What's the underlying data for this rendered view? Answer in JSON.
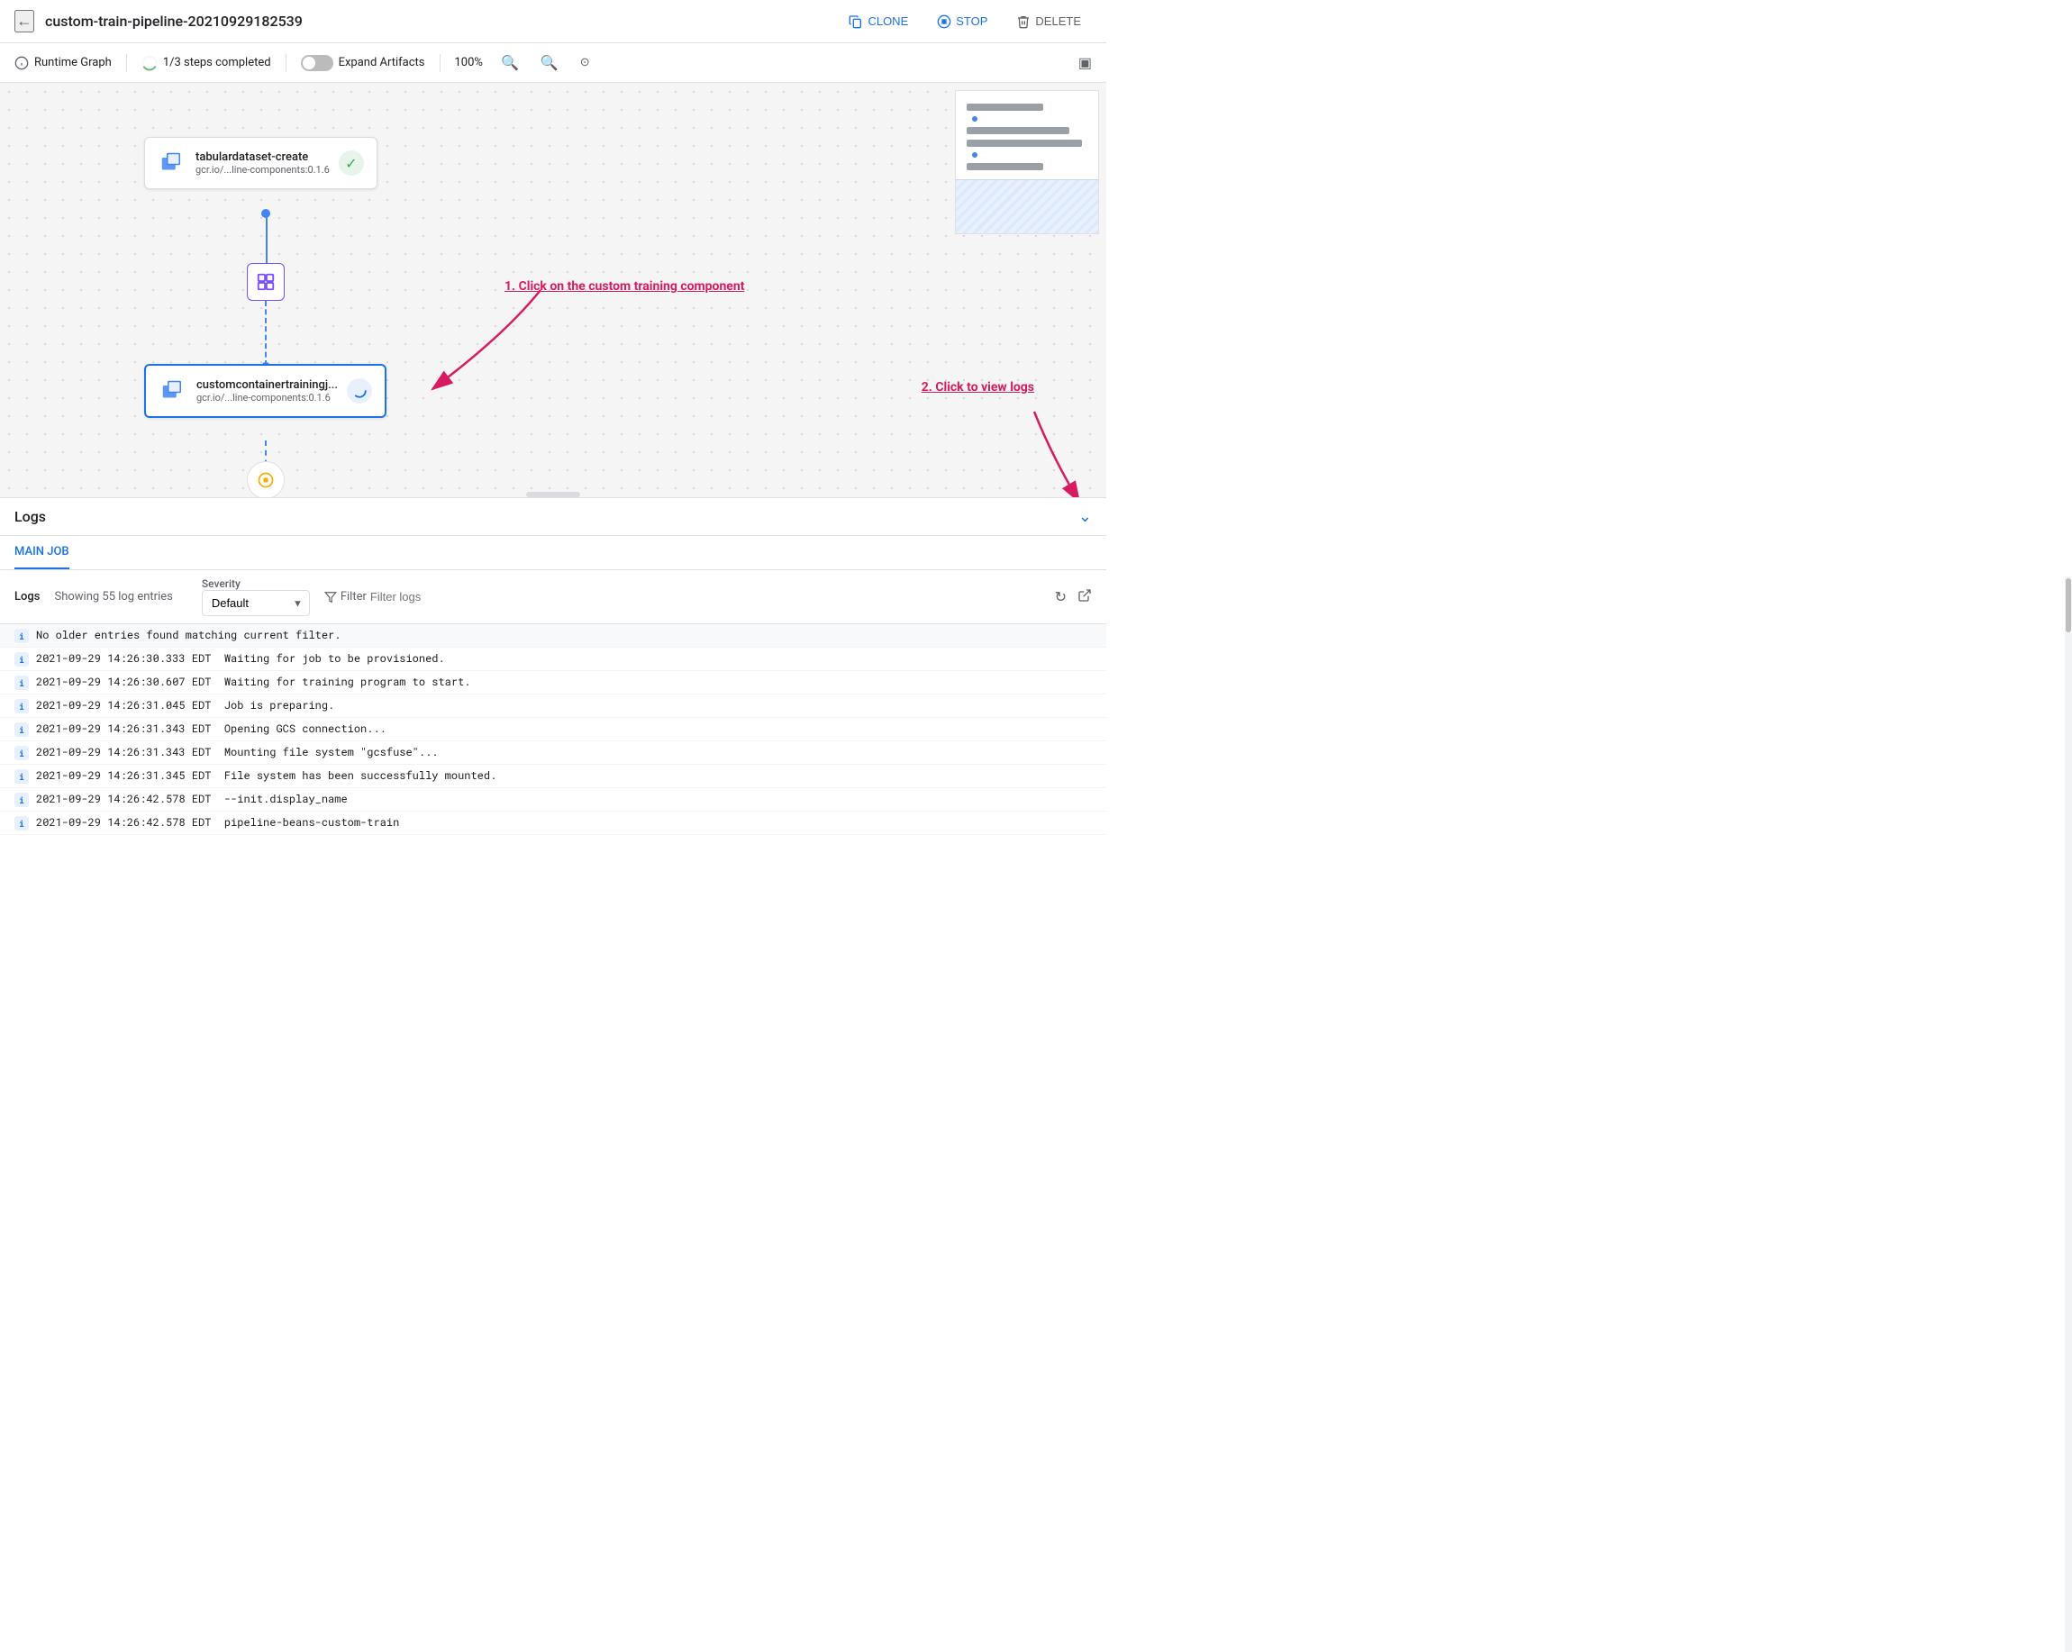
{
  "header": {
    "back_label": "←",
    "title": "custom-train-pipeline-20210929182539",
    "clone_label": "CLONE",
    "stop_label": "STOP",
    "delete_label": "DELETE"
  },
  "toolbar": {
    "runtime_graph_label": "Runtime Graph",
    "steps_completed_label": "1/3 steps completed",
    "expand_artifacts_label": "Expand Artifacts",
    "zoom_level": "100%"
  },
  "pipeline": {
    "node1": {
      "name": "tabulardataset-create",
      "sub": "gcr.io/...line-components:0.1.6",
      "status": "success"
    },
    "node2": {
      "name": "customcontainertrainingj...",
      "sub": "gcr.io/...line-components:0.1.6",
      "status": "running"
    }
  },
  "annotations": {
    "step1": "1. Click on the custom training component",
    "step2": "2. Click to view logs"
  },
  "logs": {
    "title": "Logs",
    "tab_main": "MAIN JOB",
    "label": "Logs",
    "count": "Showing 55 log entries",
    "severity_label": "Severity",
    "severity_default": "Default",
    "filter_placeholder": "Filter logs",
    "entries": [
      {
        "type": "info-plain",
        "text": "No older entries found matching current filter."
      },
      {
        "type": "info",
        "text": "2021-09-29 14:26:30.333 EDT  Waiting for job to be provisioned."
      },
      {
        "type": "info",
        "text": "2021-09-29 14:26:30.607 EDT  Waiting for training program to start."
      },
      {
        "type": "info",
        "text": "2021-09-29 14:26:31.045 EDT  Job is preparing."
      },
      {
        "type": "info",
        "text": "2021-09-29 14:26:31.343 EDT  Opening GCS connection..."
      },
      {
        "type": "info",
        "text": "2021-09-29 14:26:31.343 EDT  Mounting file system \"gcsfuse\"..."
      },
      {
        "type": "info",
        "text": "2021-09-29 14:26:31.345 EDT  File system has been successfully mounted."
      },
      {
        "type": "info",
        "text": "2021-09-29 14:26:42.578 EDT  --init.display_name"
      },
      {
        "type": "info",
        "text": "2021-09-29 14:26:42.578 EDT  pipeline-beans-custom-train"
      }
    ]
  }
}
